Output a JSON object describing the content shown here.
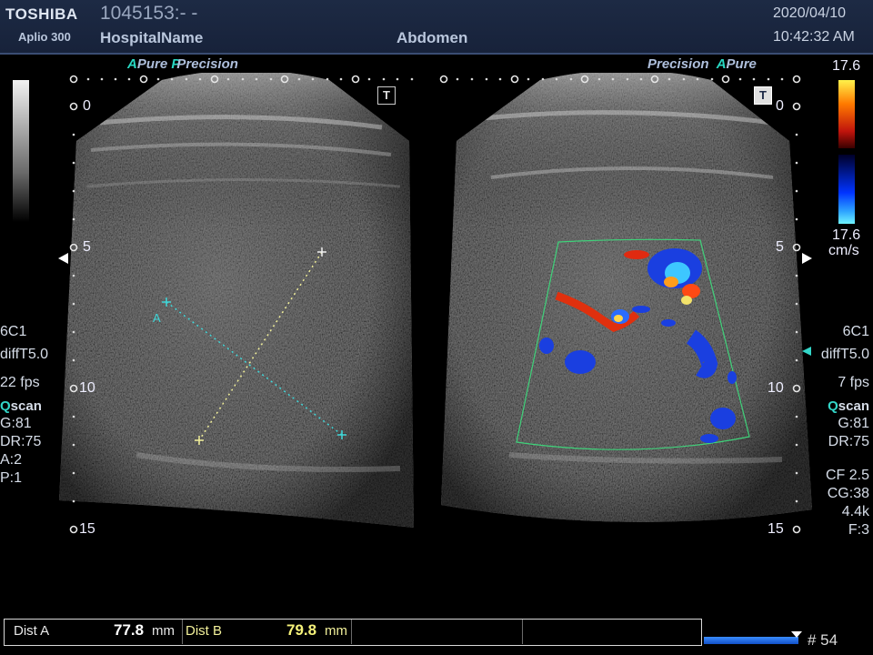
{
  "header": {
    "brand": "TOSHIBA",
    "model": "Aplio 300",
    "patient_id": "1045153:- -",
    "hospital": "HospitalName",
    "exam": "Abdomen",
    "date": "2020/04/10",
    "time": "10:42:32 AM"
  },
  "left_image": {
    "tag_a": "A",
    "tag_pure": "Pure",
    "tag_precision": "Precision",
    "t_label": "T",
    "depth": {
      "d0": "0",
      "d5": "5",
      "d10": "10",
      "d15": "15"
    },
    "probe": "6C1",
    "preset": "diffT5.0",
    "fps": "22 fps",
    "q": "Q",
    "scan": "scan",
    "gain": "G:81",
    "dr": "DR:75",
    "a": "A:2",
    "p": "P:1",
    "caliper_label": "A"
  },
  "right_image": {
    "tag_precision": "Precision",
    "tag_a": "A",
    "tag_pure": "Pure",
    "t_label": "T",
    "depth": {
      "d0": "0",
      "d5": "5",
      "d10": "10",
      "d15": "15"
    },
    "probe": "6C1",
    "preset": "diffT5.0",
    "fps": "7 fps",
    "q": "Q",
    "scan": "scan",
    "gain": "G:81",
    "dr": "DR:75",
    "cf": "CF 2.5",
    "cg": "CG:38",
    "prf": "4.4k",
    "f": "F:3"
  },
  "color_scale": {
    "top": "17.6",
    "bottom": "17.6",
    "unit": "cm/s"
  },
  "measurements": {
    "dist_a_label": "Dist A",
    "dist_a_value": "77.8",
    "dist_b_label": "Dist B",
    "dist_b_value": "79.8",
    "unit": "mm"
  },
  "cine": {
    "frame": "# 54"
  },
  "colors": {
    "caliper_a": "#3fd7d9",
    "caliper_b": "#f2f09a",
    "header_bg": "#1b2846",
    "accent_cyan": "#28d7c2",
    "roi_green": "#3fd27a"
  }
}
